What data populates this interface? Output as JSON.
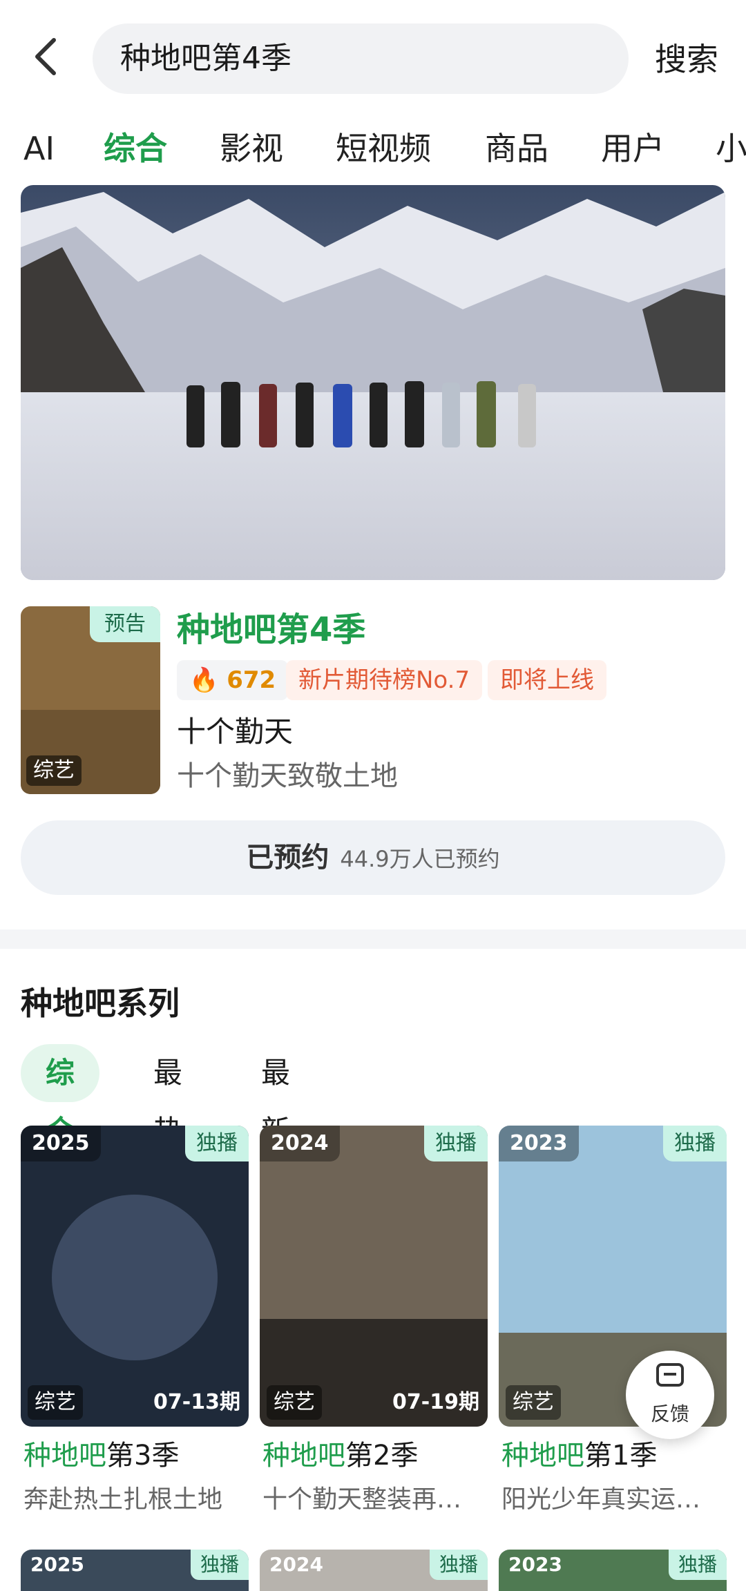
{
  "search": {
    "query": "种地吧第4季",
    "button": "搜索"
  },
  "tabs": [
    "AI",
    "综合",
    "影视",
    "短视频",
    "商品",
    "用户",
    "小"
  ],
  "show": {
    "trailer_badge": "预告",
    "poster_tag": "综艺",
    "title": "种地吧第4季",
    "heat": "672",
    "rank_chip": "新片期待榜No.7",
    "status_chip": "即将上线",
    "subtitle": "十个勤天",
    "description": "十个勤天致敬土地",
    "reserve_label": "已预约",
    "reserve_count": "44.9万人已预约"
  },
  "series": {
    "title": "种地吧系列",
    "filters": [
      "综合",
      "最热",
      "最新"
    ],
    "cards": [
      {
        "year": "2025",
        "badge": "独播",
        "genre": "综艺",
        "episode": "07-13期",
        "title_green": "种地吧",
        "title_rest": "第3季",
        "sub": "奔赴热土扎根土地"
      },
      {
        "year": "2024",
        "badge": "独播",
        "genre": "综艺",
        "episode": "07-19期",
        "title_green": "种地吧",
        "title_rest": "第2季",
        "sub": "十个勤天整装再…"
      },
      {
        "year": "2023",
        "badge": "独播",
        "genre": "综艺",
        "episode": "",
        "title_green": "种地吧",
        "title_rest": "第1季",
        "sub": "阳光少年真实运…"
      }
    ],
    "peek": [
      {
        "year": "2025",
        "badge": "独播"
      },
      {
        "year": "2024",
        "badge": "独播"
      },
      {
        "year": "2023",
        "badge": "独播"
      }
    ]
  },
  "feedback": "反馈",
  "colors": {
    "accent": "#1f9d4c",
    "chip_text": "#e25a36",
    "heat": "#e08a00"
  }
}
